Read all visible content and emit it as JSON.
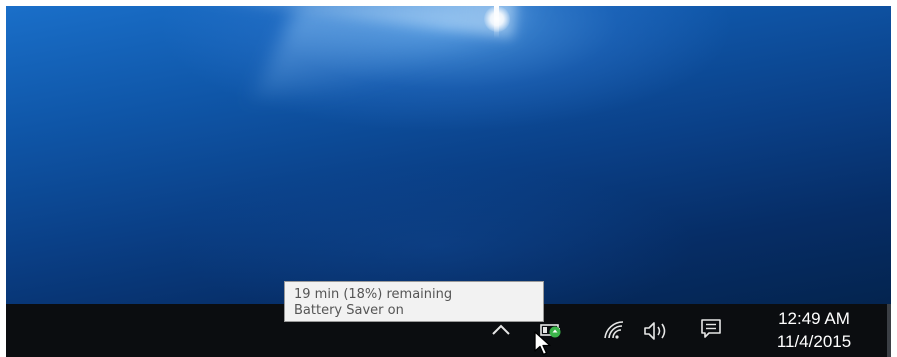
{
  "tooltip": {
    "line1": "19 min (18%) remaining",
    "line2": "Battery Saver on"
  },
  "tray": {
    "icons": [
      "chevron-up-icon",
      "battery-saver-icon",
      "wifi-icon",
      "speaker-icon",
      "action-center-icon"
    ]
  },
  "clock": {
    "time": "12:49 AM",
    "date": "11/4/2015"
  },
  "colors": {
    "taskbar": "#0b0d10",
    "desktop_blue": "#0a3f86",
    "battery_saver_green": "#3bb54a",
    "tooltip_bg": "#f2f2f2"
  }
}
